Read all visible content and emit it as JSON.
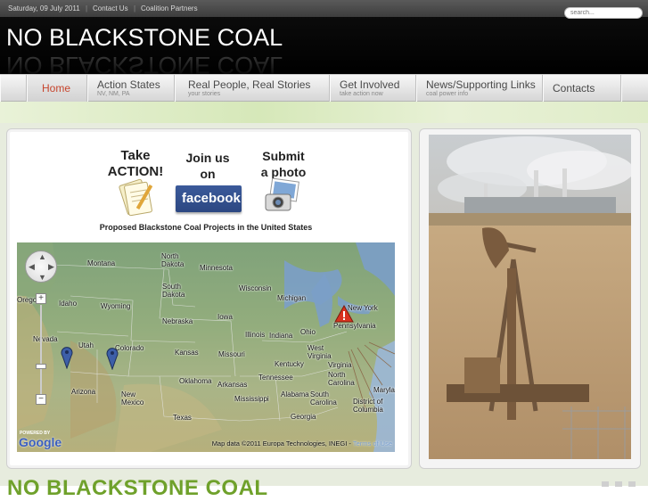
{
  "topbar": {
    "date": "Saturday, 09 July 2011",
    "links": [
      "Contact Us",
      "Coalition Partners"
    ],
    "separator": "|"
  },
  "search": {
    "placeholder": "search..."
  },
  "site": {
    "title": "NO BLACKSTONE COAL"
  },
  "nav": {
    "items": [
      {
        "label": "Home",
        "sub": ""
      },
      {
        "label": "Action States",
        "sub": "NV, NM, PA"
      },
      {
        "label": "Real People, Real Stories",
        "sub": "your stories"
      },
      {
        "label": "Get Involved",
        "sub": "take action now"
      },
      {
        "label": "News/Supporting Links",
        "sub": "coal power info"
      },
      {
        "label": "Contacts",
        "sub": ""
      }
    ]
  },
  "promos": {
    "take_action": [
      "Take",
      "ACTION!"
    ],
    "facebook": [
      "Join us",
      "on"
    ],
    "facebook_logo": "facebook",
    "photo": [
      "Submit",
      "a photo"
    ]
  },
  "map": {
    "caption": "Proposed Blackstone Coal Projects in the United States",
    "states": [
      "Montana",
      "North Dakota",
      "Minnesota",
      "South Dakota",
      "Wisconsin",
      "Michigan",
      "Idaho",
      "Wyoming",
      "Nebraska",
      "Iowa",
      "New York",
      "Nevada",
      "Utah",
      "Colorado",
      "Illinois",
      "Indiana",
      "Ohio",
      "Pennsylvania",
      "Kansas",
      "Missouri",
      "West Virginia",
      "Kentucky",
      "Virginia",
      "Arizona",
      "New Mexico",
      "Oklahoma",
      "Arkansas",
      "Tennessee",
      "North Carolina",
      "Maryland",
      "Mississippi",
      "Alabama",
      "South Carolina",
      "District of Columbia",
      "Texas",
      "Georgia",
      "Oregon"
    ],
    "powered_by": "POWERED BY",
    "google": "Google",
    "attribution": "Map data ©2011 Europa Technologies, INEGI - ",
    "terms": "Terms of Use"
  },
  "bottom": {
    "title": "NO BLACKSTONE COAL"
  },
  "colors": {
    "accent_home": "#c7452d",
    "title_green": "#6fa12b",
    "header_bg": "#000000"
  }
}
